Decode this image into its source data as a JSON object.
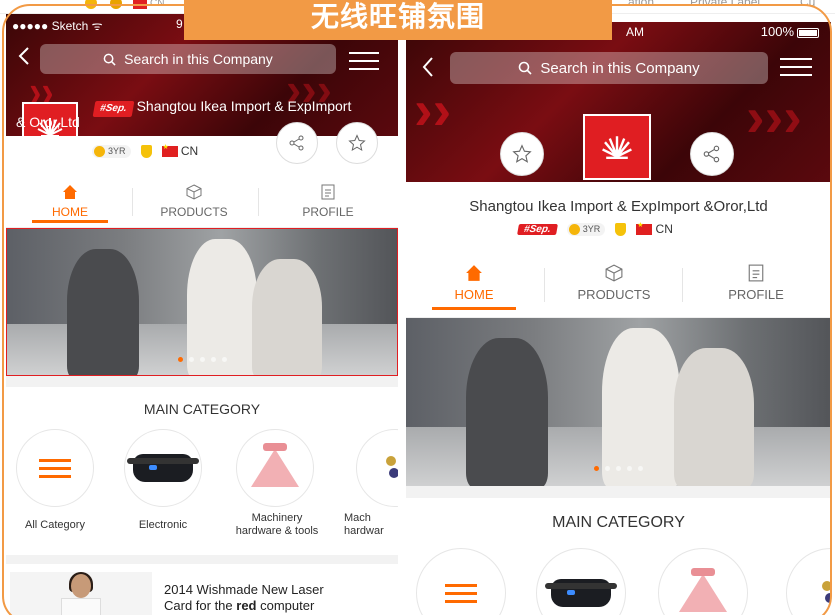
{
  "banner": {
    "title": "无线旺铺氛围"
  },
  "backdrop": {
    "cn": "CN",
    "r1": "ation",
    "r2": "Private Label",
    "r3": "Cu"
  },
  "left": {
    "status": {
      "carrier": "●●●●● Sketch ᯤ",
      "time": "9"
    },
    "search_placeholder": "Search in this Company",
    "company": {
      "sep_badge": "#Sep.",
      "name_line1": "Shangtou Ikea Import & ExpImport",
      "name_line2": "& Oror,Ltd",
      "years": "3YR",
      "country": "CN"
    },
    "tabs": [
      {
        "label": "HOME"
      },
      {
        "label": "PRODUCTS"
      },
      {
        "label": "PROFILE"
      }
    ],
    "main_category": "MAIN CATEGORY",
    "categories": [
      {
        "label": "All Category",
        "icon": "list-icon"
      },
      {
        "label": "Electronic",
        "icon": "vr-headset-icon"
      },
      {
        "label": "Machinery\nhardware & tools",
        "icon": "skirt-icon"
      },
      {
        "label": "Mach\nhardwar",
        "icon": "jewelry-icon"
      }
    ],
    "product": {
      "title_pre": "2014 Wishmade New Laser",
      "title_line2_pre": "Card for the ",
      "title_bold": "red",
      "title_post": " computer"
    }
  },
  "right": {
    "status": {
      "time": "AM",
      "battery": "100%"
    },
    "search_placeholder": "Search in this Company",
    "company": {
      "name": "Shangtou Ikea Import & ExpImport &Oror,Ltd",
      "sep_badge": "#Sep.",
      "years": "3YR",
      "country": "CN"
    },
    "tabs": [
      {
        "label": "HOME"
      },
      {
        "label": "PRODUCTS"
      },
      {
        "label": "PROFILE"
      }
    ],
    "main_category": "MAIN CATEGORY"
  },
  "colors": {
    "accent": "#ff6a00",
    "brand_red": "#e01e22",
    "banner": "#f29a45"
  }
}
